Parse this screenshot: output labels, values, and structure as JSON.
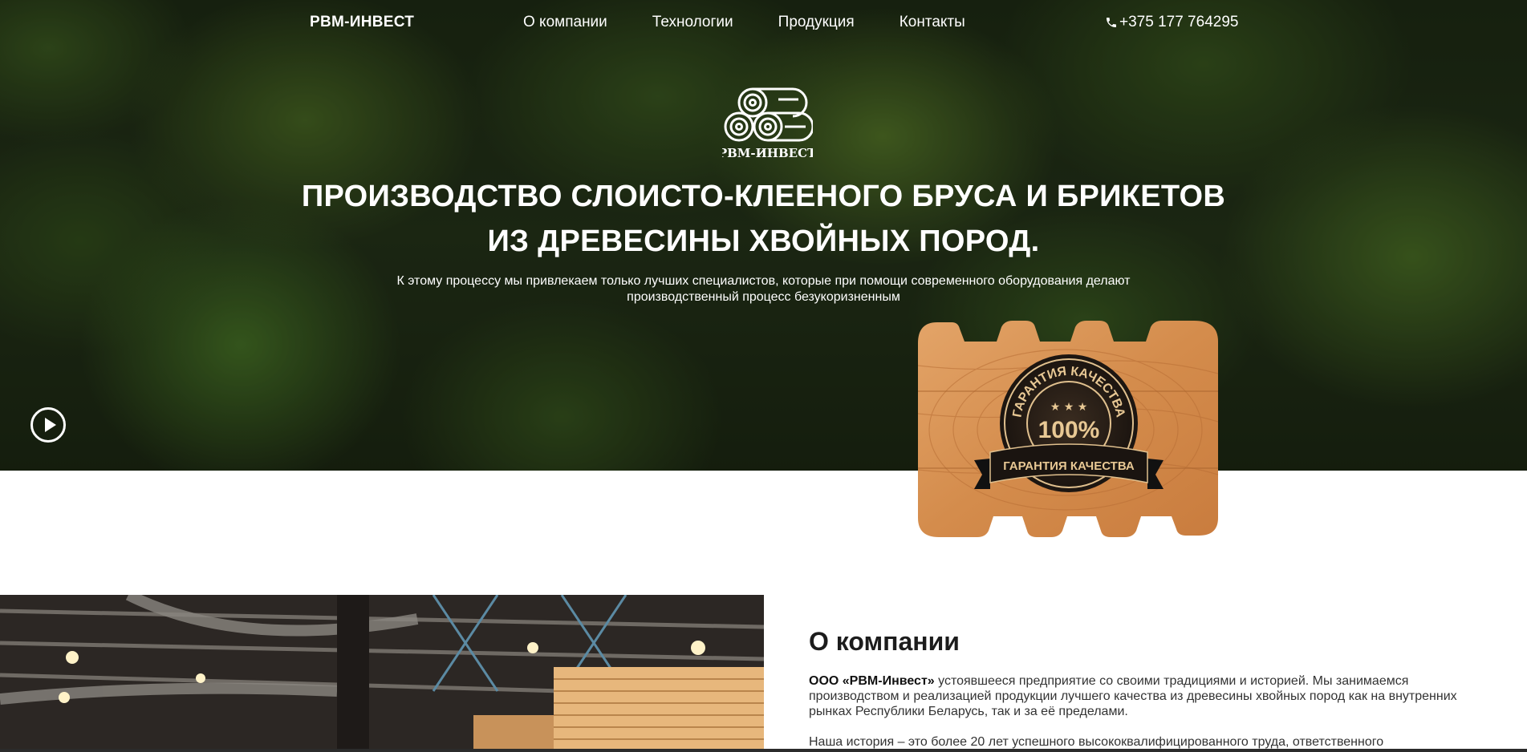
{
  "nav": {
    "brand": "РВМ-ИНВЕСТ",
    "links": [
      "О компании",
      "Технологии",
      "Продукция",
      "Контакты"
    ],
    "phone": "+375 177 764295"
  },
  "hero": {
    "logo_text": "РВМ-ИНВЕСТ",
    "headline_line1": "ПРОИЗВОДСТВО СЛОИСТО-КЛЕЕНОГО БРУСА И БРИКЕТОВ",
    "headline_line2": "ИЗ ДРЕВЕСИНЫ ХВОЙНЫХ ПОРОД.",
    "subline_line1": "К этому процессу мы привлекаем только лучших специалистов, которые при помощи современного оборудования делают",
    "subline_line2": "производственный процесс безукоризненным"
  },
  "badge": {
    "arc_text": "ГАРАНТИЯ КАЧЕСТВА",
    "percent": "100%",
    "ribbon_text": "ГАРАНТИЯ КАЧЕСТВА"
  },
  "about": {
    "title": "О компании",
    "company_name": "ООО «РВМ-Инвест»",
    "paragraph1": " устоявшееся предприятие со своими традициями и историей. Мы занимаемся производством и реализацией продукции лучшего качества из древесины хвойных пород как на внутренних рынках Республики Беларусь, так и за её пределами.",
    "paragraph2": "Наша история – это более 20 лет успешного высококвалифицированного труда, ответственного"
  },
  "icons": {
    "phone": "phone-icon",
    "play": "play-icon",
    "logo": "logs-logo-icon"
  }
}
